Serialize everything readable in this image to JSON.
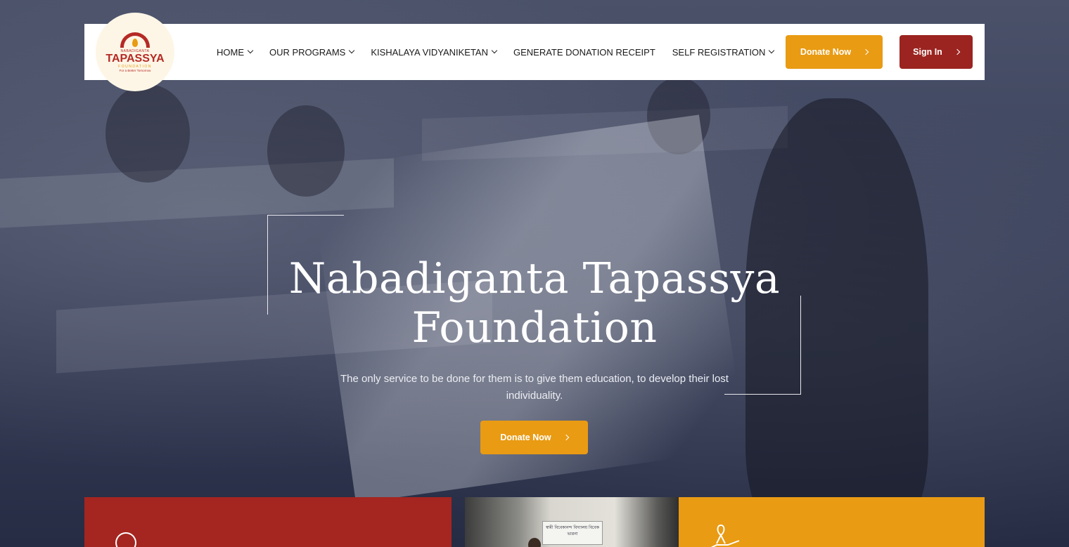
{
  "header": {
    "logo": {
      "small_text": "NABADIGANTA",
      "main_text": "TAPASSYA",
      "sub_text": "FOUNDATION",
      "tagline": "For a Better Tomorrow"
    },
    "nav": [
      {
        "label": "HOME",
        "dropdown": true
      },
      {
        "label": "OUR PROGRAMS",
        "dropdown": true
      },
      {
        "label": "KISHALAYA VIDYANIKETAN",
        "dropdown": true
      },
      {
        "label": "GENERATE DONATION RECEIPT",
        "dropdown": false
      },
      {
        "label": "SELF REGISTRATION",
        "dropdown": true
      }
    ],
    "donate_label": "Donate Now",
    "signin_label": "Sign In"
  },
  "hero": {
    "title": "Nabadiganta Tapassya Foundation",
    "subtitle": "The only service to be done for them is to give them education, to develop their lost individuality.",
    "donate_label": "Donate Now"
  },
  "cards": {
    "photo_sign_text": "স্বামী বিবেকানন্দ বিদ্যালয় বিবেক ভাৱনা"
  },
  "colors": {
    "accent_orange": "#e99b13",
    "accent_red": "#9b2420",
    "card_red": "#a52520",
    "overlay_navy": "#2b3250"
  },
  "icons": [
    "chevron-down-icon",
    "chevron-right-icon",
    "target-icon",
    "ribbon-hand-icon"
  ]
}
